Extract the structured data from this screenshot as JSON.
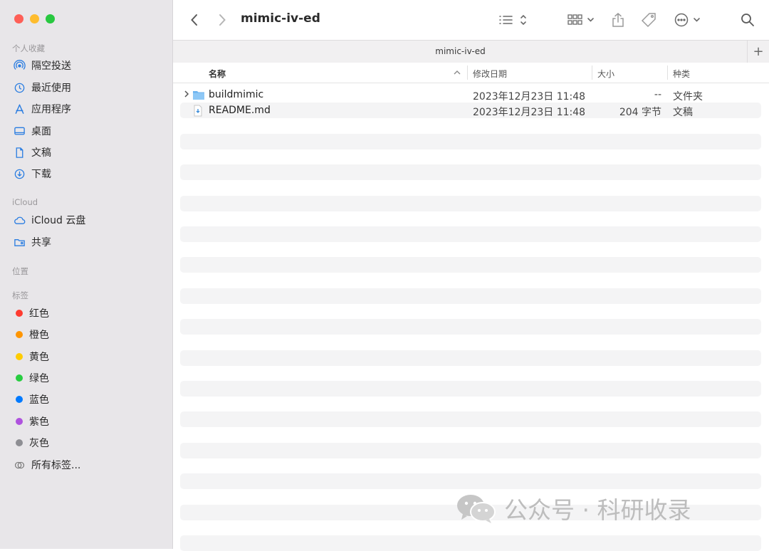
{
  "window": {
    "title": "mimic-iv-ed",
    "tab_label": "mimic-iv-ed",
    "tab_add": "+"
  },
  "sidebar": {
    "favorites_header": "个人收藏",
    "favorites": [
      {
        "label": "隔空投送",
        "icon": "airdrop-icon"
      },
      {
        "label": "最近使用",
        "icon": "clock-icon"
      },
      {
        "label": "应用程序",
        "icon": "applications-icon"
      },
      {
        "label": "桌面",
        "icon": "desktop-icon"
      },
      {
        "label": "文稿",
        "icon": "document-icon"
      },
      {
        "label": "下载",
        "icon": "download-icon"
      }
    ],
    "icloud_header": "iCloud",
    "icloud": [
      {
        "label": "iCloud 云盘",
        "icon": "cloud-icon"
      },
      {
        "label": "共享",
        "icon": "shared-folder-icon"
      }
    ],
    "locations_header": "位置",
    "tags_header": "标签",
    "tags": [
      {
        "label": "红色",
        "color": "#fe3b30"
      },
      {
        "label": "橙色",
        "color": "#fe9500"
      },
      {
        "label": "黄色",
        "color": "#fecc00"
      },
      {
        "label": "绿色",
        "color": "#28cd41"
      },
      {
        "label": "蓝色",
        "color": "#007aff"
      },
      {
        "label": "紫色",
        "color": "#af52de"
      },
      {
        "label": "灰色",
        "color": "#8e8e93"
      }
    ],
    "all_tags": "所有标签..."
  },
  "columns": {
    "name": "名称",
    "date": "修改日期",
    "size": "大小",
    "kind": "种类"
  },
  "files": [
    {
      "name": "buildmimic",
      "date": "2023年12月23日 11:48",
      "size": "--",
      "kind": "文件夹",
      "icon": "folder-icon"
    },
    {
      "name": "README.md",
      "date": "2023年12月23日 11:48",
      "size": "204 字节",
      "kind": "文稿",
      "icon": "markdown-file-icon"
    }
  ],
  "watermark": "公众号 · 科研收录"
}
